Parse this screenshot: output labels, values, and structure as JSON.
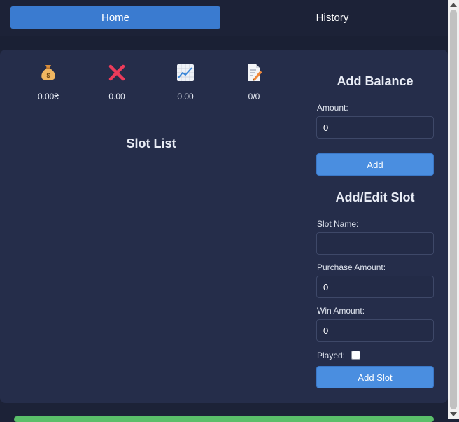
{
  "nav": {
    "home_label": "Home",
    "history_label": "History"
  },
  "stats": [
    {
      "icon": "money-bag-icon",
      "value": "0.00₴"
    },
    {
      "icon": "red-x-icon",
      "value": "0.00"
    },
    {
      "icon": "chart-up-icon",
      "value": "0.00"
    },
    {
      "icon": "memo-icon",
      "value": "0/0"
    }
  ],
  "slot_list": {
    "title": "Slot List"
  },
  "add_balance": {
    "title": "Add Balance",
    "amount_label": "Amount:",
    "amount_value": "0",
    "add_button": "Add"
  },
  "add_edit_slot": {
    "title": "Add/Edit Slot",
    "slot_name_label": "Slot Name:",
    "slot_name_value": "",
    "purchase_label": "Purchase Amount:",
    "purchase_value": "0",
    "win_label": "Win Amount:",
    "win_value": "0",
    "played_label": "Played:",
    "played_checked": false,
    "submit_button": "Add Slot"
  },
  "colors": {
    "background": "#1c2237",
    "card": "#252d4a",
    "accent": "#4a8ee0",
    "active_tab": "#3a7bd0",
    "success_bar": "#5bbf6a"
  }
}
